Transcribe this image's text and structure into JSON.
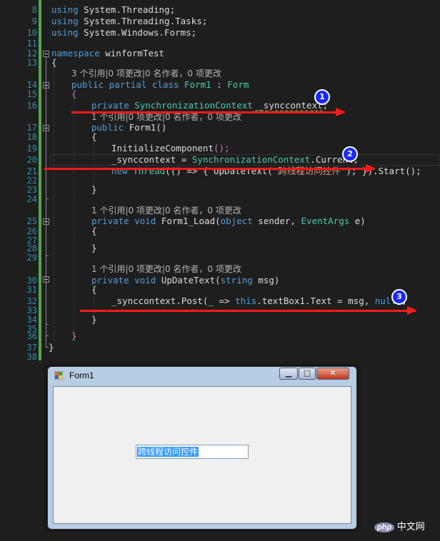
{
  "editor": {
    "line_numbers": [
      "8",
      "9",
      "10",
      "11",
      "12",
      "13",
      "14",
      "15",
      "16",
      "17",
      "18",
      "19",
      "20",
      "21",
      "22",
      "23",
      "24",
      "25",
      "26",
      "27",
      "28",
      "29",
      "30",
      "31",
      "32",
      "33",
      "34",
      "35",
      "36",
      "37",
      "38"
    ],
    "lines": {
      "l8": {
        "a": "using",
        "b": " System.Threading;"
      },
      "l9": {
        "a": "using",
        "b": " System.Threading.Tasks;"
      },
      "l10": {
        "a": "using",
        "b": " System.Windows.Forms;"
      },
      "l12": {
        "a": "namespace",
        "b": " winformTest"
      },
      "l13": "{",
      "ref1": "3 个引用|0 项更改|0 名作者，0 项更改",
      "l14": {
        "a": "public partial class",
        "b": "Form1",
        "c": " : ",
        "d": "Form"
      },
      "l15": "{",
      "l16": {
        "a": "private",
        "b": "SynchronizationContext",
        "c": " _synccontext",
        "d": ";"
      },
      "ref2": "1 个引用|0 项更改|0 名作者，0 项更改",
      "l17": {
        "a": "public",
        "b": " Form1()"
      },
      "l18": "{",
      "l19": {
        "a": "InitializeComponent",
        "b": "();"
      },
      "l20": {
        "a": "_synccontext = ",
        "b": "SynchronizationContext",
        "c": ".Current;"
      },
      "l21": {
        "a": "new",
        "b": " Thread",
        "c": "(() => { UpDateText(",
        "d": "\"跨线程访问控件\"",
        "e": "); }).Start();"
      },
      "l23": "}",
      "ref3": "1 个引用|0 项更改|0 名作者，0 项更改",
      "l25": {
        "a": "private void",
        "b": " Form1_Load(",
        "c": "object",
        "d": " sender, ",
        "e": "EventArgs",
        "f": " e)"
      },
      "l26": "{",
      "l28": "}",
      "ref4": "1 个引用|0 项更改|0 名作者，0 项更改",
      "l30": {
        "a": "private void",
        "b": " UpDateText(",
        "c": "string",
        "d": " msg)"
      },
      "l31": "{",
      "l32": {
        "a": "_synccontext.Post(_ => ",
        "b": "this",
        "c": ".textBox1.Text = msg, ",
        "d": "null",
        "e": ");"
      },
      "l33": "}",
      "l35": "}",
      "l37": "}"
    }
  },
  "annotations": {
    "b1": "1",
    "b2": "2",
    "b3": "3",
    "arrow_color": "#ff1a1a",
    "badge_color": "#1a2aff"
  },
  "form": {
    "title": "Form1",
    "minimize": "▁",
    "maximize": "□",
    "close": "✕",
    "textbox_value": "跨线程访问控件"
  },
  "watermark": {
    "logo": "php",
    "text": "中文网"
  }
}
